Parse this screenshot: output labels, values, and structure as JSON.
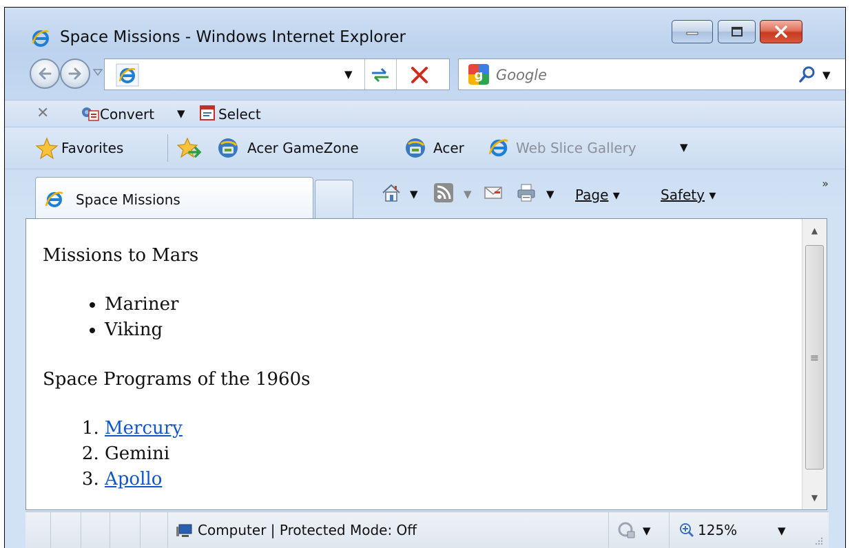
{
  "window": {
    "title": "Space Missions - Windows Internet Explorer"
  },
  "search": {
    "placeholder": "Google"
  },
  "converter_bar": {
    "convert_label": "Convert",
    "select_label": "Select"
  },
  "favorites_bar": {
    "favorites_label": "Favorites",
    "items": [
      {
        "label": "Acer GameZone",
        "icon": "acer-gamezone-icon"
      },
      {
        "label": "Acer",
        "icon": "acer-icon"
      },
      {
        "label": "Web Slice Gallery",
        "icon": "ie-icon"
      }
    ]
  },
  "tab": {
    "label": "Space Missions"
  },
  "command_bar": {
    "page_label": "Page",
    "safety_label": "Safety",
    "chevron": "»"
  },
  "content": {
    "heading1": "Missions to Mars",
    "mars_missions": [
      "Mariner",
      "Viking"
    ],
    "heading2": "Space Programs of the 1960s",
    "programs": [
      {
        "label": "Mercury",
        "link": true
      },
      {
        "label": "Gemini",
        "link": false
      },
      {
        "label": "Apollo",
        "link": true
      }
    ]
  },
  "status_bar": {
    "zone_text": "Computer | Protected Mode: Off",
    "zoom": "125%"
  },
  "colors": {
    "link": "#1155cc",
    "close_button": "#c73a20",
    "chrome": "#c6d9f1"
  }
}
